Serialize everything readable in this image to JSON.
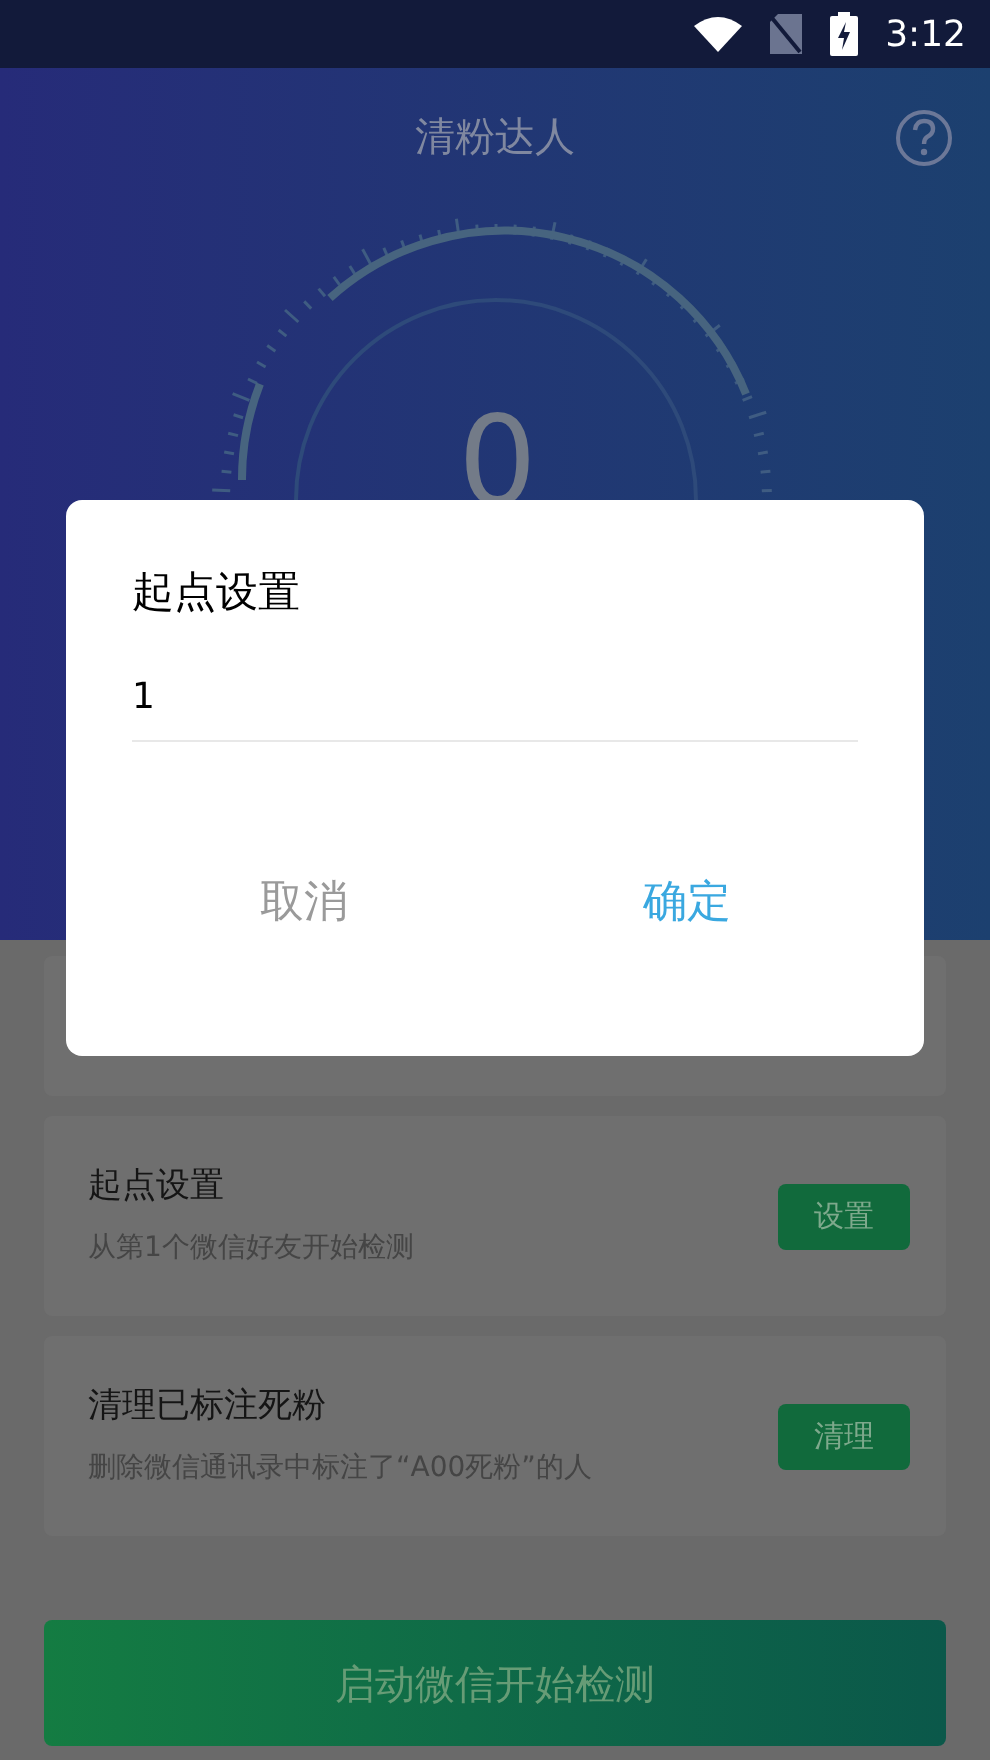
{
  "status_bar": {
    "time": "3:12"
  },
  "header": {
    "title": "清粉达人"
  },
  "gauge": {
    "value": "0"
  },
  "cards": [
    {
      "title": "起点设置",
      "description": "从第1个微信好友开始检测",
      "button": "设置"
    },
    {
      "title": "清理已标注死粉",
      "description": "删除微信通讯录中标注了“A00死粉”的人",
      "button": "清理"
    }
  ],
  "start_button": "启动微信开始检测",
  "dialog": {
    "title": "起点设置",
    "value": "1",
    "buttons": [
      {
        "label": "取消",
        "kind": "cancel"
      },
      {
        "label": "确定",
        "kind": "confirm"
      }
    ]
  }
}
